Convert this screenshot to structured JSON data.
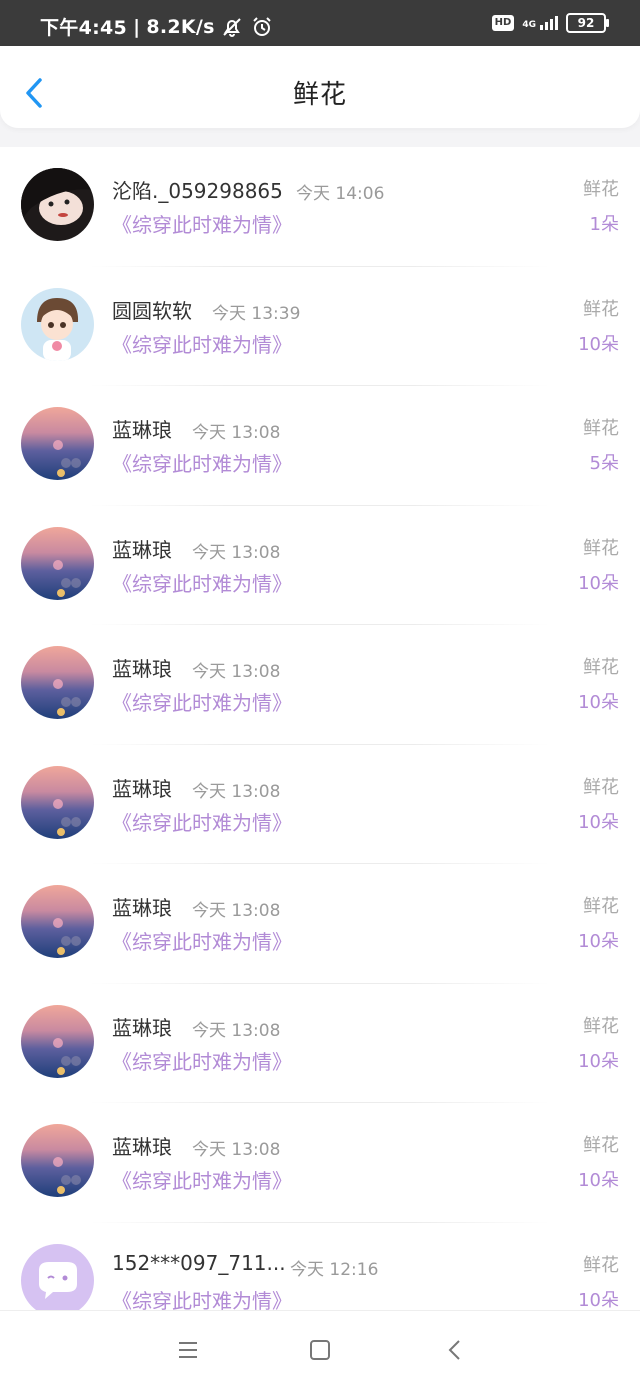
{
  "status_bar": {
    "time": "下午4:45",
    "speed": "8.2K/s",
    "hd": "HD",
    "network": "4G",
    "battery": "92",
    "icons": [
      "bell-off-icon",
      "alarm-icon",
      "signal-icon",
      "battery-icon"
    ]
  },
  "header": {
    "title": "鲜花",
    "back_icon": "chevron-left-icon",
    "accent_color": "#2196f3"
  },
  "colors": {
    "purple": "#b28bd6",
    "gray": "#9a9a9a"
  },
  "rows": [
    {
      "name": "沦陷._059298865",
      "time": "今天 14:06",
      "book": "《综穿此时难为情》",
      "gift": "鲜花",
      "count": "1朵",
      "avatar": "photo-girl"
    },
    {
      "name": "圆圆软软",
      "time": "今天 13:39",
      "book": "《综穿此时难为情》",
      "gift": "鲜花",
      "count": "10朵",
      "avatar": "cartoon-boy"
    },
    {
      "name": "蓝琳琅",
      "time": "今天 13:08",
      "book": "《综穿此时难为情》",
      "gift": "鲜花",
      "count": "5朵",
      "avatar": "sunset"
    },
    {
      "name": "蓝琳琅",
      "time": "今天 13:08",
      "book": "《综穿此时难为情》",
      "gift": "鲜花",
      "count": "10朵",
      "avatar": "sunset"
    },
    {
      "name": "蓝琳琅",
      "time": "今天 13:08",
      "book": "《综穿此时难为情》",
      "gift": "鲜花",
      "count": "10朵",
      "avatar": "sunset"
    },
    {
      "name": "蓝琳琅",
      "time": "今天 13:08",
      "book": "《综穿此时难为情》",
      "gift": "鲜花",
      "count": "10朵",
      "avatar": "sunset"
    },
    {
      "name": "蓝琳琅",
      "time": "今天 13:08",
      "book": "《综穿此时难为情》",
      "gift": "鲜花",
      "count": "10朵",
      "avatar": "sunset"
    },
    {
      "name": "蓝琳琅",
      "time": "今天 13:08",
      "book": "《综穿此时难为情》",
      "gift": "鲜花",
      "count": "10朵",
      "avatar": "sunset"
    },
    {
      "name": "蓝琳琅",
      "time": "今天 13:08",
      "book": "《综穿此时难为情》",
      "gift": "鲜花",
      "count": "10朵",
      "avatar": "sunset"
    },
    {
      "name": "152***097_711...",
      "time": "今天 12:16",
      "book": "《综穿此时难为情》",
      "gift": "鲜花",
      "count": "10朵",
      "avatar": "default-chat"
    }
  ],
  "nav": {
    "icons": [
      "menu-icon",
      "home-square-icon",
      "back-triangle-icon"
    ]
  }
}
